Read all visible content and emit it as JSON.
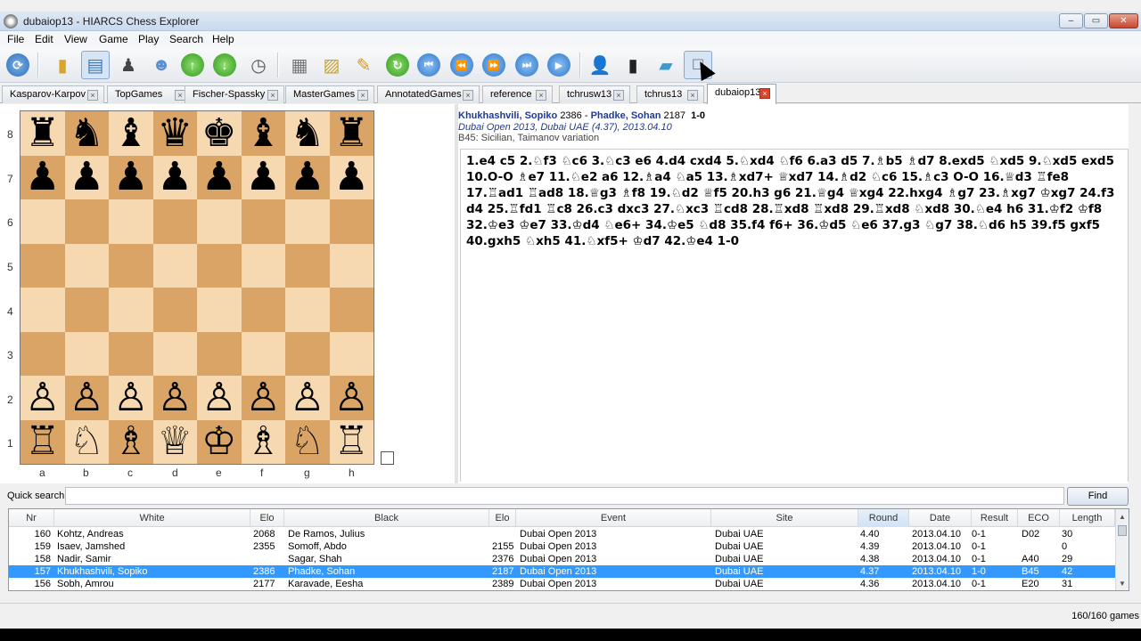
{
  "window": {
    "title": "dubaiop13 - HIARCS Chess Explorer",
    "controls": {
      "minimize": "–",
      "maximize": "▭",
      "close": "✕"
    }
  },
  "menu": [
    "File",
    "Edit",
    "View",
    "Game",
    "Play",
    "Search",
    "Help"
  ],
  "toolbar": {
    "icons": [
      "refresh-icon",
      "new-database-icon",
      "database-properties-icon",
      "players-icon",
      "opponents-icon",
      "upload-icon",
      "download-icon",
      "clock-icon",
      "board-icon",
      "edit-board-icon",
      "notepad-icon",
      "engine-icon",
      "first-move-icon",
      "prev-move-icon",
      "next-move-icon",
      "last-move-icon",
      "play-icon",
      "player-photo-icon",
      "engine-tower-icon",
      "book-icon",
      "pointer-icon"
    ]
  },
  "tabs": [
    {
      "label": "Kasparov-Karpov"
    },
    {
      "label": "TopGames"
    },
    {
      "label": "Fischer-Spassky"
    },
    {
      "label": "MasterGames"
    },
    {
      "label": "AnnotatedGames"
    },
    {
      "label": "reference"
    },
    {
      "label": "tchrusw13"
    },
    {
      "label": "tchrus13"
    },
    {
      "label": "dubaiop13",
      "active": true
    }
  ],
  "board": {
    "ranks": [
      "8",
      "7",
      "6",
      "5",
      "4",
      "3",
      "2",
      "1"
    ],
    "files": [
      "a",
      "b",
      "c",
      "d",
      "e",
      "f",
      "g",
      "h"
    ],
    "position": [
      [
        "♜",
        "♞",
        "♝",
        "♛",
        "♚",
        "♝",
        "♞",
        "♜"
      ],
      [
        "♟",
        "♟",
        "♟",
        "♟",
        "♟",
        "♟",
        "♟",
        "♟"
      ],
      [
        "",
        "",
        "",
        "",
        "",
        "",
        "",
        ""
      ],
      [
        "",
        "",
        "",
        "",
        "",
        "",
        "",
        ""
      ],
      [
        "",
        "",
        "",
        "",
        "",
        "",
        "",
        ""
      ],
      [
        "",
        "",
        "",
        "",
        "",
        "",
        "",
        ""
      ],
      [
        "♙",
        "♙",
        "♙",
        "♙",
        "♙",
        "♙",
        "♙",
        "♙"
      ],
      [
        "♖",
        "♘",
        "♗",
        "♕",
        "♔",
        "♗",
        "♘",
        "♖"
      ]
    ]
  },
  "game": {
    "white": "Khukhashvili, Sopiko",
    "white_elo": "2386",
    "black": "Phadke, Sohan",
    "black_elo": "2187",
    "result": "1-0",
    "event_line": "Dubai Open 2013, Dubai UAE (4.37), 2013.04.10",
    "opening": "B45: Sicilian, Taimanov variation",
    "moves": "1.e4 c5 2.♘f3 ♘c6 3.♘c3 e6 4.d4 cxd4 5.♘xd4 ♘f6 6.a3 d5 7.♗b5 ♗d7 8.exd5 ♘xd5 9.♘xd5 exd5 10.O-O ♗e7 11.♘e2 a6 12.♗a4 ♘a5 13.♗xd7+ ♕xd7 14.♗d2 ♘c6 15.♗c3 O-O 16.♕d3 ♖fe8 17.♖ad1 ♖ad8 18.♕g3 ♗f8 19.♘d2 ♕f5 20.h3 g6 21.♕g4 ♕xg4 22.hxg4 ♗g7 23.♗xg7 ♔xg7 24.f3 d4 25.♖fd1 ♖c8 26.c3 dxc3 27.♘xc3 ♖cd8 28.♖xd8 ♖xd8 29.♖xd8 ♘xd8 30.♘e4 h6 31.♔f2 ♔f8 32.♔e3 ♔e7 33.♔d4 ♘e6+ 34.♔e5 ♘d8 35.f4 f6+ 36.♔d5 ♘e6 37.g3 ♘g7 38.♘d6 h5 39.f5 gxf5 40.gxh5 ♘xh5 41.♘xf5+ ♔d7 42.♔e4 1-0"
  },
  "search": {
    "label": "Quick search:",
    "value": "",
    "placeholder": "",
    "button": "Find"
  },
  "table": {
    "columns": [
      "Nr",
      "White",
      "Elo",
      "Black",
      "Elo",
      "Event",
      "Site",
      "Round",
      "Date",
      "Result",
      "ECO",
      "Length"
    ],
    "sorted_column": "Round",
    "rows": [
      [
        "160",
        "Kohtz, Andreas",
        "2068",
        "De Ramos, Julius",
        "",
        "Dubai Open 2013",
        "Dubai UAE",
        "4.40",
        "2013.04.10",
        "0-1",
        "D02",
        "30"
      ],
      [
        "159",
        "Isaev, Jamshed",
        "2355",
        "Somoff, Abdo",
        "2155",
        "Dubai Open 2013",
        "Dubai UAE",
        "4.39",
        "2013.04.10",
        "0-1",
        "",
        "0"
      ],
      [
        "158",
        "Nadir, Samir",
        "",
        "Sagar, Shah",
        "2376",
        "Dubai Open 2013",
        "Dubai UAE",
        "4.38",
        "2013.04.10",
        "0-1",
        "A40",
        "29"
      ],
      [
        "157",
        "Khukhashvili, Sopiko",
        "2386",
        "Phadke, Sohan",
        "2187",
        "Dubai Open 2013",
        "Dubai UAE",
        "4.37",
        "2013.04.10",
        "1-0",
        "B45",
        "42"
      ],
      [
        "156",
        "Sobh, Amrou",
        "2177",
        "Karavade, Eesha",
        "2389",
        "Dubai Open 2013",
        "Dubai UAE",
        "4.36",
        "2013.04.10",
        "0-1",
        "E20",
        "31"
      ]
    ],
    "selected_index": 3
  },
  "status": {
    "count": "160/160 games"
  },
  "colors": {
    "selection": "#3399ff",
    "light_square": "#f6d9b0",
    "dark_square": "#d9a466",
    "player_link": "#1e3a9a"
  }
}
